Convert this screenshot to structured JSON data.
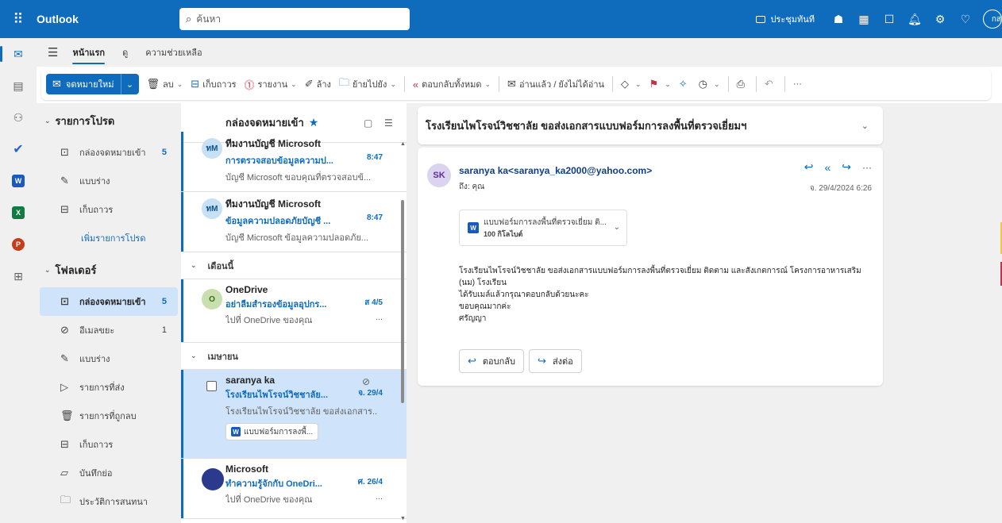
{
  "topbar": {
    "app_name": "Outlook",
    "search_placeholder": "ค้นหา",
    "meet_now": "ประชุมทันที",
    "account_initials": "กส"
  },
  "ribbon": {
    "tabs": [
      "หน้าแรก",
      "ดู",
      "ความช่วยเหลือ"
    ],
    "new_mail": "จดหมายใหม่",
    "delete": "ลบ",
    "archive": "เก็บถาวร",
    "report": "รายงาน",
    "sweep": "ล้าง",
    "move_to": "ย้ายไปยัง",
    "reply_all": "ตอบกลับทั้งหมด",
    "read_unread": "อ่านแล้ว / ยังไม่ได้อ่าน",
    "more": "···"
  },
  "folders": {
    "favorites_title": "รายการโปรด",
    "favorites": [
      {
        "label": "กล่องจดหมายเข้า",
        "count": "5"
      },
      {
        "label": "แบบร่าง",
        "count": ""
      },
      {
        "label": "เก็บถาวร",
        "count": ""
      }
    ],
    "add_favorite": "เพิ่มรายการโปรด",
    "folders_title": "โฟลเดอร์",
    "items": [
      {
        "label": "กล่องจดหมายเข้า",
        "count": "5"
      },
      {
        "label": "อีเมลขยะ",
        "count": "1"
      },
      {
        "label": "แบบร่าง",
        "count": ""
      },
      {
        "label": "รายการที่ส่ง",
        "count": ""
      },
      {
        "label": "รายการที่ถูกลบ",
        "count": ""
      },
      {
        "label": "เก็บถาวร",
        "count": ""
      },
      {
        "label": "บันทึกย่อ",
        "count": ""
      },
      {
        "label": "ประวัติการสนทนา",
        "count": ""
      }
    ]
  },
  "message_list": {
    "title": "กล่องจดหมายเข้า",
    "messages_top": [
      {
        "initials": "ทM",
        "sender": "ทีมงานบัญชี Microsoft",
        "subject": "การตรวจสอบข้อมูลความป...",
        "date": "8:47",
        "preview": "บัญชี Microsoft ขอบคุณที่ตรวจสอบข้..."
      },
      {
        "initials": "ทM",
        "sender": "ทีมงานบัญชี Microsoft",
        "subject": "ข้อมูลความปลอดภัยบัญชี ...",
        "date": "8:47",
        "preview": "บัญชี Microsoft ข้อมูลความปลอดภัย..."
      }
    ],
    "group_this_month": "เดือนนี้",
    "message_onedrive": {
      "initials": "O",
      "sender": "OneDrive",
      "subject": "อย่าลืมสำรองข้อมูลอุปกร...",
      "date": "ส 4/5",
      "preview": "ไปที่ OneDrive ของคุณ",
      "preview_tail": "..."
    },
    "group_april": "เมษายน",
    "message_selected": {
      "sender": "saranya ka",
      "subject": "โรงเรียนไพโรจน์วิชชาลัย...",
      "date": "จ. 29/4",
      "preview": "โรงเรียนไพโรจน์วิชชาลัย ขอส่งเอกสาร...",
      "attachment": "แบบฟอร์มการลงพื้..."
    },
    "message_microsoft": {
      "sender": "Microsoft",
      "subject": "ทำความรู้จักกับ OneDri...",
      "date": "ศ. 26/4",
      "preview": "ไปที่ OneDrive ของคุณ",
      "preview_tail": "..."
    }
  },
  "reading": {
    "subject": "โรงเรียนไพโรจน์วิชชาลัย  ขอส่งเอกสารแบบฟอร์มการลงพื้นที่ตรวจเยี่ยมฯ",
    "initials": "SK",
    "from": "saranya ka<saranya_ka2000@yahoo.com>",
    "to": "ถึง: คุณ",
    "date": "จ. 29/4/2024 6:26",
    "attachment_name": "แบบฟอร์มการลงพื้นที่ตรวจเยี่ยม ติ...",
    "attachment_size": "100 กิโลไบต์",
    "body_lines": [
      "โรงเรียนไพโรจน์วิชชาลัย  ขอส่งเอกสารแบบฟอร์มการลงพื้นที่ตรวจเยี่ยม ติดตาม และสังเกตการณ์ โครงการอาหารเสริม",
      "(นม) โรงเรียน",
      "ได้รับเมล์แล้วกรุณาตอบกลับด้วยนะคะ",
      "ขอบคุณมากค่ะ",
      "ศรัญญา"
    ],
    "reply": "ตอบกลับ",
    "forward": "ส่งต่อ"
  },
  "colors": {
    "brand": "#0f6cbd",
    "selected": "#cfe4fa",
    "pane_bg": "#f0f0f0"
  }
}
